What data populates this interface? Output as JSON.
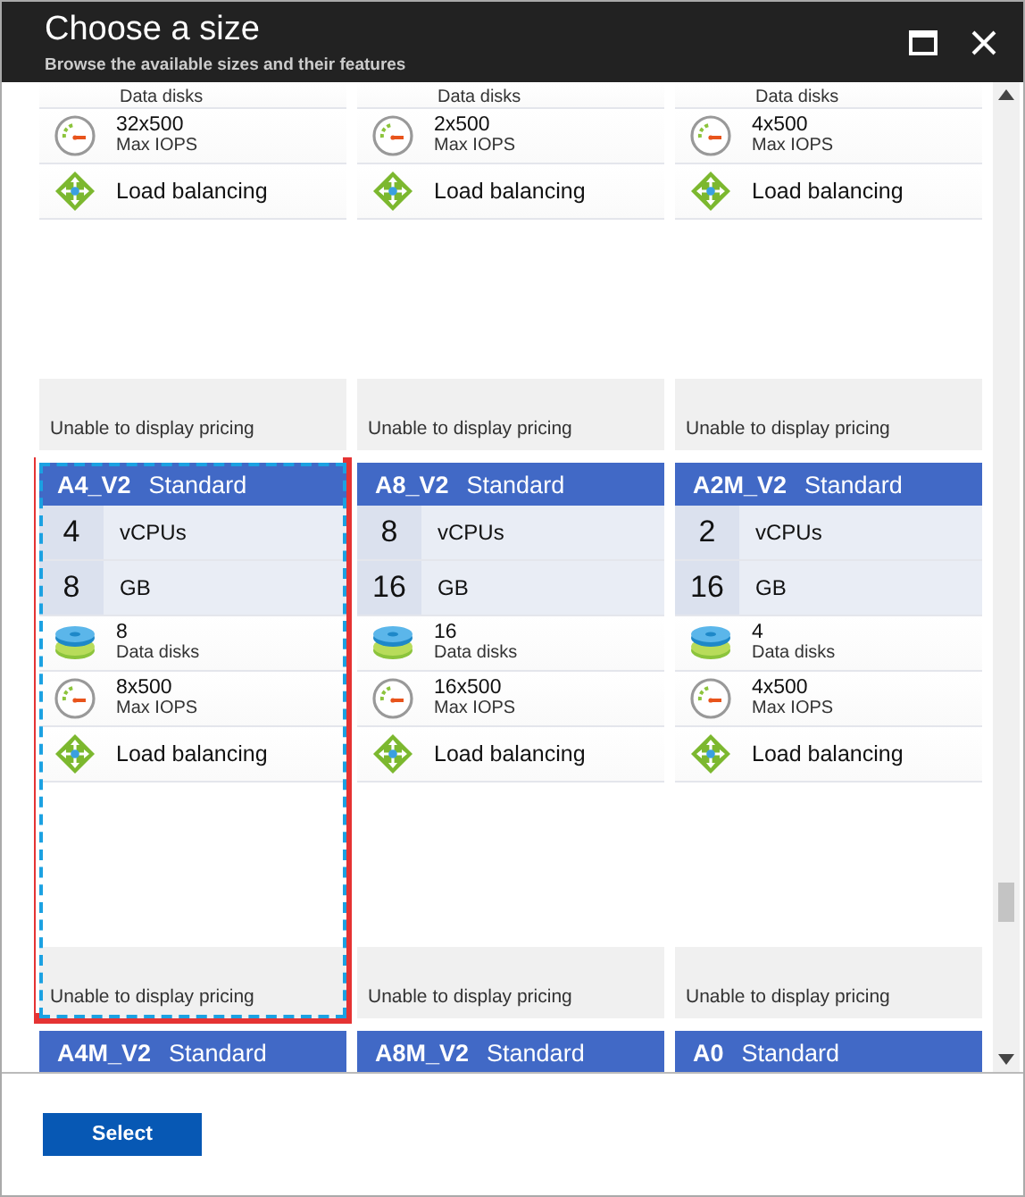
{
  "window": {
    "title": "Choose a size",
    "subtitle": "Browse the available sizes and their features"
  },
  "cards": [
    {
      "selected": false,
      "features": [
        {
          "kind": "disks",
          "label": "Data disks"
        },
        {
          "kind": "iops",
          "value": "32x500",
          "label": "Max IOPS"
        },
        {
          "kind": "balancing",
          "label": "Load balancing"
        }
      ],
      "pricing": "Unable to display pricing"
    },
    {
      "selected": false,
      "features": [
        {
          "kind": "disks",
          "label": "Data disks"
        },
        {
          "kind": "iops",
          "value": "2x500",
          "label": "Max IOPS"
        },
        {
          "kind": "balancing",
          "label": "Load balancing"
        }
      ],
      "pricing": "Unable to display pricing"
    },
    {
      "selected": false,
      "features": [
        {
          "kind": "disks",
          "label": "Data disks"
        },
        {
          "kind": "iops",
          "value": "4x500",
          "label": "Max IOPS"
        },
        {
          "kind": "balancing",
          "label": "Load balancing"
        }
      ],
      "pricing": "Unable to display pricing"
    },
    {
      "name": "A4_V2",
      "tier": "Standard",
      "selected": true,
      "features": [
        {
          "kind": "cpu",
          "value": "4",
          "label": "vCPUs"
        },
        {
          "kind": "memory",
          "value": "8",
          "label": "GB"
        },
        {
          "kind": "disks",
          "value": "8",
          "label": "Data disks"
        },
        {
          "kind": "iops",
          "value": "8x500",
          "label": "Max IOPS"
        },
        {
          "kind": "balancing",
          "label": "Load balancing"
        }
      ],
      "pricing": "Unable to display pricing"
    },
    {
      "name": "A8_V2",
      "tier": "Standard",
      "selected": false,
      "features": [
        {
          "kind": "cpu",
          "value": "8",
          "label": "vCPUs"
        },
        {
          "kind": "memory",
          "value": "16",
          "label": "GB"
        },
        {
          "kind": "disks",
          "value": "16",
          "label": "Data disks"
        },
        {
          "kind": "iops",
          "value": "16x500",
          "label": "Max IOPS"
        },
        {
          "kind": "balancing",
          "label": "Load balancing"
        }
      ],
      "pricing": "Unable to display pricing"
    },
    {
      "name": "A2M_V2",
      "tier": "Standard",
      "selected": false,
      "features": [
        {
          "kind": "cpu",
          "value": "2",
          "label": "vCPUs"
        },
        {
          "kind": "memory",
          "value": "16",
          "label": "GB"
        },
        {
          "kind": "disks",
          "value": "4",
          "label": "Data disks"
        },
        {
          "kind": "iops",
          "value": "4x500",
          "label": "Max IOPS"
        },
        {
          "kind": "balancing",
          "label": "Load balancing"
        }
      ],
      "pricing": "Unable to display pricing"
    },
    {
      "name": "A4M_V2",
      "tier": "Standard",
      "selected": false
    },
    {
      "name": "A8M_V2",
      "tier": "Standard",
      "selected": false
    },
    {
      "name": "A0",
      "tier": "Standard",
      "selected": false
    }
  ],
  "footer": {
    "button": "Select"
  }
}
